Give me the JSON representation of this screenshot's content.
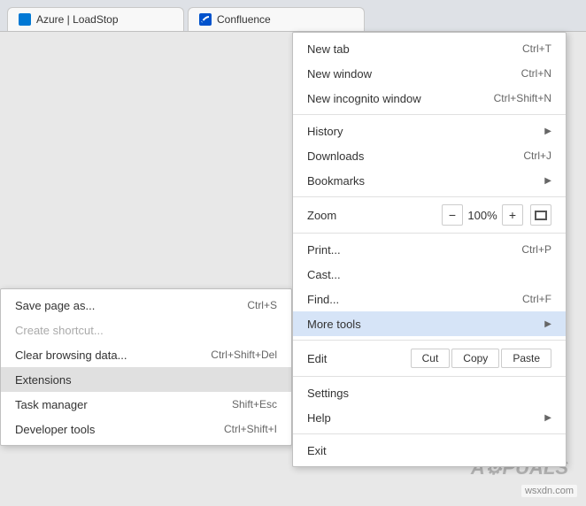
{
  "browser": {
    "tab1": {
      "label": "Azure | LoadStop",
      "favicon_color": "#0078d4"
    },
    "tab2": {
      "label": "Confluence",
      "favicon_color": "#0052cc"
    }
  },
  "left_submenu": {
    "items": [
      {
        "id": "save-page-as",
        "label": "Save page as...",
        "shortcut": "Ctrl+S",
        "disabled": false,
        "highlighted": false
      },
      {
        "id": "create-shortcut",
        "label": "Create shortcut...",
        "shortcut": "",
        "disabled": true,
        "highlighted": false
      },
      {
        "id": "clear-browsing-data",
        "label": "Clear browsing data...",
        "shortcut": "Ctrl+Shift+Del",
        "disabled": false,
        "highlighted": false
      },
      {
        "id": "extensions",
        "label": "Extensions",
        "shortcut": "",
        "disabled": false,
        "highlighted": true
      },
      {
        "id": "task-manager",
        "label": "Task manager",
        "shortcut": "Shift+Esc",
        "disabled": false,
        "highlighted": false
      },
      {
        "id": "developer-tools",
        "label": "Developer tools",
        "shortcut": "Ctrl+Shift+I",
        "disabled": false,
        "highlighted": false
      }
    ]
  },
  "right_menu": {
    "items": [
      {
        "id": "new-tab",
        "label": "New tab",
        "shortcut": "Ctrl+T",
        "type": "item"
      },
      {
        "id": "new-window",
        "label": "New window",
        "shortcut": "Ctrl+N",
        "type": "item"
      },
      {
        "id": "new-incognito-window",
        "label": "New incognito window",
        "shortcut": "Ctrl+Shift+N",
        "type": "item"
      },
      {
        "id": "separator1",
        "type": "separator"
      },
      {
        "id": "history",
        "label": "History",
        "shortcut": "",
        "type": "item-arrow"
      },
      {
        "id": "downloads",
        "label": "Downloads",
        "shortcut": "Ctrl+J",
        "type": "item"
      },
      {
        "id": "bookmarks",
        "label": "Bookmarks",
        "shortcut": "",
        "type": "item-arrow"
      },
      {
        "id": "separator2",
        "type": "separator"
      },
      {
        "id": "zoom",
        "label": "Zoom",
        "type": "zoom",
        "minus": "−",
        "value": "100%",
        "plus": "+"
      },
      {
        "id": "separator3",
        "type": "separator"
      },
      {
        "id": "print",
        "label": "Print...",
        "shortcut": "Ctrl+P",
        "type": "item"
      },
      {
        "id": "cast",
        "label": "Cast...",
        "shortcut": "",
        "type": "item"
      },
      {
        "id": "find",
        "label": "Find...",
        "shortcut": "Ctrl+F",
        "type": "item"
      },
      {
        "id": "more-tools",
        "label": "More tools",
        "shortcut": "",
        "type": "item-arrow",
        "highlighted": true
      },
      {
        "id": "separator4",
        "type": "separator"
      },
      {
        "id": "edit",
        "label": "Edit",
        "type": "edit",
        "cut_label": "Cut",
        "copy_label": "Copy",
        "paste_label": "Paste"
      },
      {
        "id": "separator5",
        "type": "separator"
      },
      {
        "id": "settings",
        "label": "Settings",
        "shortcut": "",
        "type": "item"
      },
      {
        "id": "help",
        "label": "Help",
        "shortcut": "",
        "type": "item-arrow"
      },
      {
        "id": "separator6",
        "type": "separator"
      },
      {
        "id": "exit",
        "label": "Exit",
        "shortcut": "",
        "type": "item"
      }
    ]
  },
  "watermark": "wsxdn.com"
}
